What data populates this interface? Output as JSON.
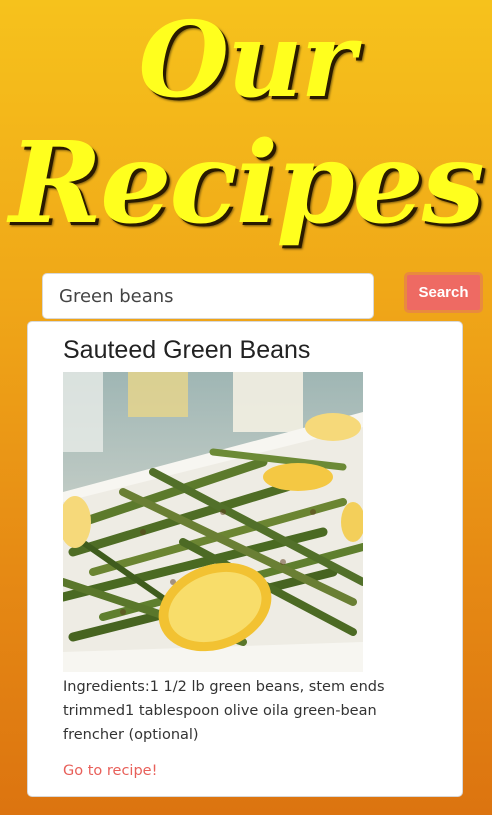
{
  "header": {
    "title_line1": "Our",
    "title_line2": "Recipes"
  },
  "search": {
    "value": "Green beans",
    "button_label": "Search"
  },
  "results": [
    {
      "title": "Sauteed Green Beans",
      "image_alt": "Sauteed green beans with lemon slices on a white plate",
      "ingredients": "Ingredients:1 1/2 lb green beans, stem ends trimmed1 tablespoon olive oila green-bean frencher (optional)",
      "link_label": "Go to recipe!"
    }
  ],
  "colors": {
    "title": "#ffff1e",
    "search_button": "#ee6a63",
    "link": "#e8605a",
    "background_top": "#f6c21c",
    "background_bottom": "#dc7410"
  }
}
